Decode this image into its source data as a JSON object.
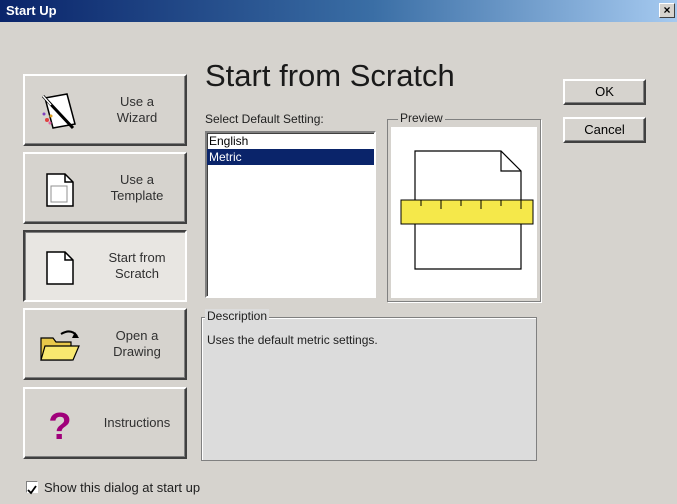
{
  "window": {
    "title": "Start Up",
    "close_label": "×"
  },
  "nav": [
    {
      "label": "Use a\nWizard",
      "icon": "wizard-icon"
    },
    {
      "label": "Use a\nTemplate",
      "icon": "template-icon"
    },
    {
      "label": "Start from\nScratch",
      "icon": "blank-page-icon",
      "selected": true
    },
    {
      "label": "Open a\nDrawing",
      "icon": "open-folder-icon"
    },
    {
      "label": "Instructions",
      "icon": "question-mark-icon"
    }
  ],
  "main": {
    "heading": "Start from Scratch",
    "select_label": "Select Default Setting:",
    "options": [
      "English",
      "Metric"
    ],
    "selected_option": "Metric",
    "preview_label": "Preview",
    "description_label": "Description",
    "description_text": "Uses the default metric settings."
  },
  "buttons": {
    "ok": "OK",
    "cancel": "Cancel"
  },
  "footer": {
    "show_dialog_label": "Show this dialog at start up",
    "show_dialog_checked": true
  },
  "colors": {
    "title_start": "#0a246a",
    "title_end": "#a6caf0",
    "selection": "#0a246a",
    "ruler": "#f5e84a"
  }
}
